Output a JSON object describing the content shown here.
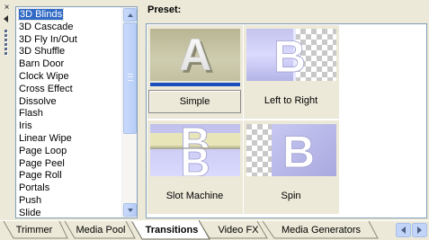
{
  "panel": {
    "close_glyph": "×",
    "icons": {
      "close": "close-icon",
      "collapse": "collapse-arrow-icon",
      "grip": "grip-icon"
    }
  },
  "transitions": {
    "items": [
      "3D Blinds",
      "3D Cascade",
      "3D Fly In/Out",
      "3D Shuffle",
      "Barn Door",
      "Clock Wipe",
      "Cross Effect",
      "Dissolve",
      "Flash",
      "Iris",
      "Linear Wipe",
      "Page Loop",
      "Page Peel",
      "Page Roll",
      "Portals",
      "Push",
      "Slide"
    ],
    "selected": "3D Blinds"
  },
  "preset": {
    "title": "Preset:",
    "items": [
      {
        "label": "Simple",
        "glyph": "A",
        "selected": true
      },
      {
        "label": "Left to Right",
        "glyph": "B",
        "selected": false
      },
      {
        "label": "Slot Machine",
        "glyph": "B",
        "selected": false
      },
      {
        "label": "Spin",
        "glyph": "B",
        "selected": false
      }
    ]
  },
  "tabs": {
    "items": [
      "Trimmer",
      "Media Pool",
      "Transitions",
      "Video FX",
      "Media Generators"
    ],
    "active": "Transitions"
  },
  "colors": {
    "selection": "#316ac5",
    "progress": "#1a4fbd",
    "panel_bg": "#ece9d8"
  }
}
